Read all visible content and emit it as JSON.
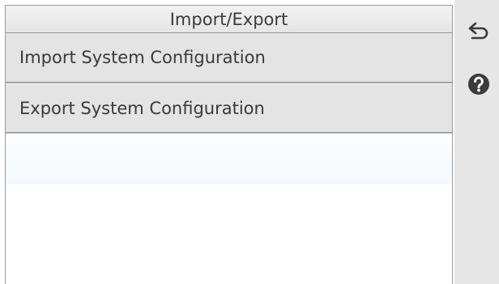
{
  "header": {
    "title": "Import/Export"
  },
  "menu": {
    "items": [
      {
        "label": "Import System Configuration"
      },
      {
        "label": "Export System Configuration"
      }
    ]
  },
  "side_panel": {
    "buttons": [
      {
        "icon": "back-arrow-icon"
      },
      {
        "icon": "question-mark-icon"
      }
    ]
  },
  "colors": {
    "panel_bg": "#e6e6e6",
    "item_bg": "#e4e4e4",
    "text": "#3a3a3a",
    "icon": "#3b3b3b"
  }
}
